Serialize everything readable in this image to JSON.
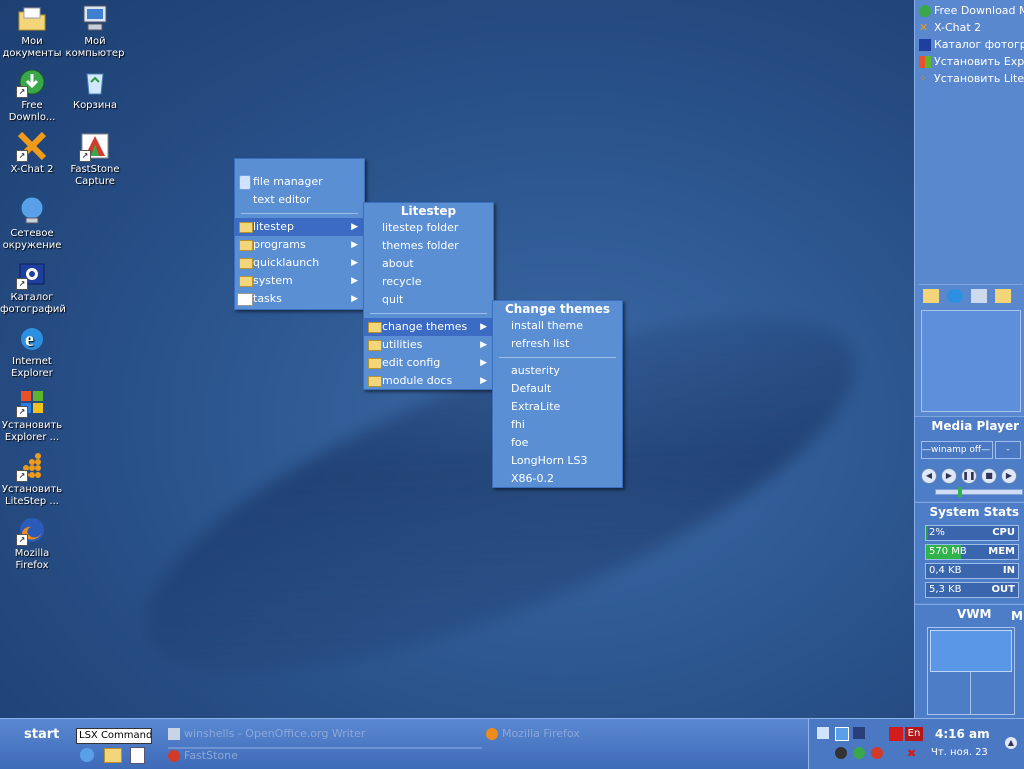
{
  "desktop_icons": [
    {
      "label": "Мои документы"
    },
    {
      "label": "Мой компьютер"
    },
    {
      "label": "Free Downlo..."
    },
    {
      "label": "Корзина"
    },
    {
      "label": "X-Chat 2"
    },
    {
      "label": "FastStone Capture"
    },
    {
      "label": "Сетевое окружение"
    },
    {
      "label": "Каталог фотографий"
    },
    {
      "label": "Internet Explorer"
    },
    {
      "label": "Установить Explorer ..."
    },
    {
      "label": "Установить LiteStep ..."
    },
    {
      "label": "Mozilla Firefox"
    }
  ],
  "main_menu": {
    "top_items": [
      "file manager",
      "text editor"
    ],
    "sub_items": [
      "litestep",
      "programs",
      "quicklaunch",
      "system",
      "tasks"
    ]
  },
  "litestep_menu": {
    "title": "Litestep",
    "items": [
      "litestep folder",
      "themes folder",
      "about",
      "recycle",
      "quit"
    ],
    "sub_items": [
      "change themes",
      "utilities",
      "edit config",
      "module docs"
    ]
  },
  "themes_menu": {
    "title": "Change themes",
    "items": [
      "install theme",
      "refresh list"
    ],
    "themes": [
      "austerity",
      "Default",
      "ExtraLite",
      "fhi",
      "foe",
      "LongHorn LS3",
      "X86-0.2"
    ]
  },
  "right_panel": {
    "launch_items": [
      "Free Download Ma",
      "X-Chat 2",
      "Каталог фотогра",
      "Установить Explo",
      "Установить LiteS"
    ],
    "media_player": {
      "title": "Media Player",
      "track": "—winamp off—",
      "extra": "-"
    },
    "system_stats": {
      "title": "System Stats",
      "rows": [
        {
          "value": "2%",
          "label": "CPU",
          "level": 0.02
        },
        {
          "value": "570 MB",
          "label": "MEM",
          "level": 0.38
        },
        {
          "value": "0,4 KB",
          "label": "IN",
          "level": 0
        },
        {
          "value": "5,3 KB",
          "label": "OUT",
          "level": 0
        }
      ]
    },
    "vwm": {
      "title": "VWM",
      "extra": "M"
    }
  },
  "taskbar": {
    "start_label": "start",
    "command_value": "LSX Command",
    "tasks": [
      "winshells - OpenOffice.org Writer",
      "FastStone",
      "Mozilla Firefox"
    ],
    "lang": "En",
    "time": "4:16 am",
    "date": "Чт. ноя. 23"
  },
  "colors": {
    "accent": "#3b6bc2",
    "menu_bg": "#5b8fd4",
    "mem_bar": "#2fb34a"
  }
}
